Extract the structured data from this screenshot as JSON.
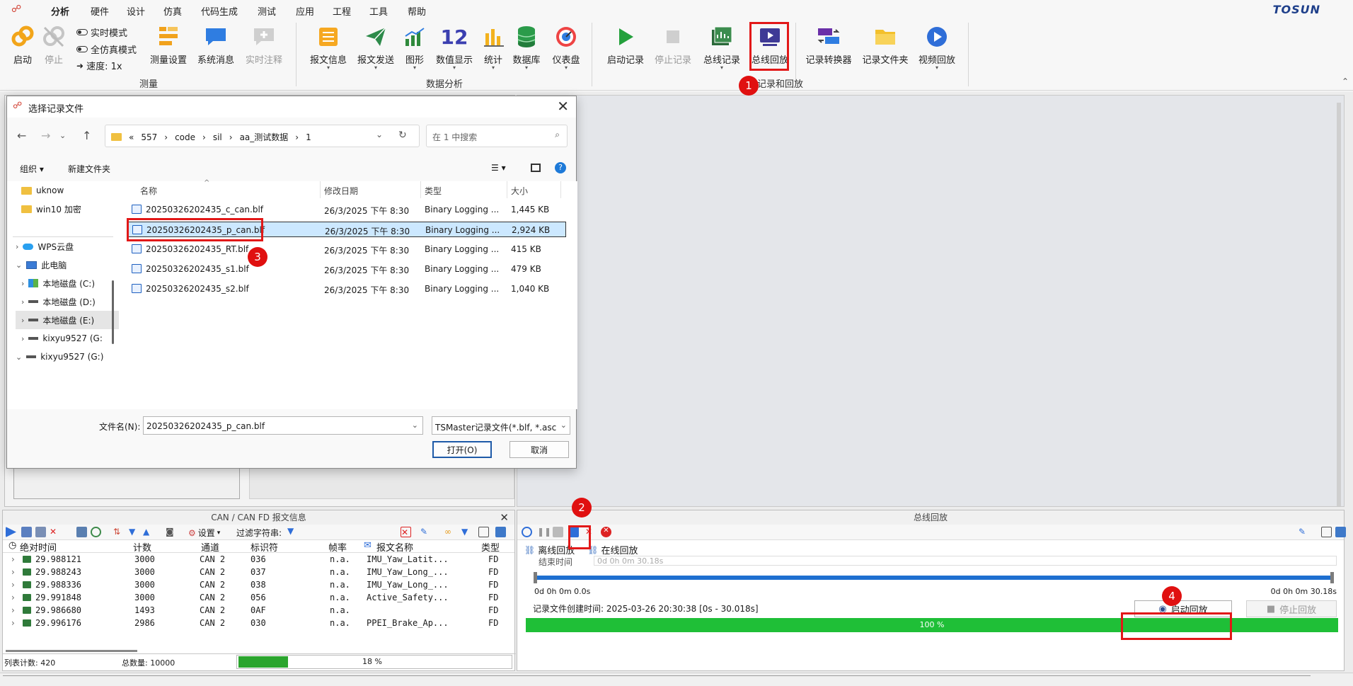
{
  "menubar": {
    "tabs": [
      "分析",
      "硬件",
      "设计",
      "仿真",
      "代码生成",
      "测试",
      "应用",
      "工程",
      "工具",
      "帮助"
    ],
    "active_tab": "分析",
    "brand": "TOSUN"
  },
  "ribbon": {
    "start_label": "启动",
    "stop_label": "停止",
    "realtime_label": "实时模式",
    "fullsim_label": "全仿真模式",
    "speed_label": "速度: 1x",
    "measure_setup_label": "测量设置",
    "sys_msg_label": "系统消息",
    "rt_annot_label": "实时注释",
    "group_measure": "测量",
    "msg_info_label": "报文信息",
    "msg_send_label": "报文发送",
    "graph_label": "图形",
    "num_display_label": "数值显示",
    "num_display_value": "12",
    "stats_label": "统计",
    "db_label": "数据库",
    "dashboard_label": "仪表盘",
    "group_data": "数据分析",
    "start_rec_label": "启动记录",
    "stop_rec_label": "停止记录",
    "bus_rec_label": "总线记录",
    "bus_replay_label": "总线回放",
    "rec_convert_label": "记录转换器",
    "rec_folder_label": "记录文件夹",
    "video_replay_label": "视频回放",
    "group_record": "记录和回放"
  },
  "dialog": {
    "title": "选择记录文件",
    "path": [
      "«",
      "557",
      "code",
      "sil",
      "aa_测试数据",
      "1"
    ],
    "search_placeholder": "在 1 中搜索",
    "organize_label": "组织 ▾",
    "new_folder_label": "新建文件夹",
    "tree": [
      {
        "label": "uknow"
      },
      {
        "label": "win10 加密"
      },
      {
        "label": "WPS云盘"
      },
      {
        "label": "此电脑"
      },
      {
        "label": "本地磁盘 (C:)"
      },
      {
        "label": "本地磁盘 (D:)"
      },
      {
        "label": "本地磁盘 (E:)"
      },
      {
        "label": "kixyu9527 (G:"
      },
      {
        "label": "kixyu9527 (G:)"
      }
    ],
    "columns": {
      "name": "名称",
      "date": "修改日期",
      "type": "类型",
      "size": "大小"
    },
    "files": [
      {
        "name": "20250326202435_c_can.blf",
        "date": "26/3/2025 下午 8:30",
        "type": "Binary Logging ...",
        "size": "1,445 KB"
      },
      {
        "name": "20250326202435_p_can.blf",
        "date": "26/3/2025 下午 8:30",
        "type": "Binary Logging ...",
        "size": "2,924 KB"
      },
      {
        "name": "20250326202435_RT.blf",
        "date": "26/3/2025 下午 8:30",
        "type": "Binary Logging ...",
        "size": "415 KB"
      },
      {
        "name": "20250326202435_s1.blf",
        "date": "26/3/2025 下午 8:30",
        "type": "Binary Logging ...",
        "size": "479 KB"
      },
      {
        "name": "20250326202435_s2.blf",
        "date": "26/3/2025 下午 8:30",
        "type": "Binary Logging ...",
        "size": "1,040 KB"
      }
    ],
    "filename_label": "文件名(N):",
    "filename_value": "20250326202435_p_can.blf",
    "filetype_value": "TSMaster记录文件(*.blf, *.asc",
    "open_label": "打开(O)",
    "cancel_label": "取消"
  },
  "can_panel": {
    "title": "CAN / CAN FD 报文信息",
    "settings_label": "设置",
    "filter_label": "过滤字符串:",
    "columns": [
      "绝对时间",
      "计数",
      "通道",
      "标识符",
      "帧率",
      "报文名称",
      "类型"
    ],
    "rows": [
      {
        "time": "29.988121",
        "count": "3000",
        "chan": "CAN 2",
        "id": "036",
        "rate": "n.a.",
        "name": "IMU_Yaw_Latit...",
        "type": "FD"
      },
      {
        "time": "29.988243",
        "count": "3000",
        "chan": "CAN 2",
        "id": "037",
        "rate": "n.a.",
        "name": "IMU_Yaw_Long_...",
        "type": "FD"
      },
      {
        "time": "29.988336",
        "count": "3000",
        "chan": "CAN 2",
        "id": "038",
        "rate": "n.a.",
        "name": "IMU_Yaw_Long_...",
        "type": "FD"
      },
      {
        "time": "29.991848",
        "count": "3000",
        "chan": "CAN 2",
        "id": "056",
        "rate": "n.a.",
        "name": "Active_Safety...",
        "type": "FD"
      },
      {
        "time": "29.986680",
        "count": "1493",
        "chan": "CAN 2",
        "id": "0AF",
        "rate": "n.a.",
        "name": "",
        "type": "FD"
      },
      {
        "time": "29.996176",
        "count": "2986",
        "chan": "CAN 2",
        "id": "030",
        "rate": "n.a.",
        "name": "PPEI_Brake_Ap...",
        "type": "FD"
      }
    ],
    "list_count": "列表计数: 420",
    "total_count": "总数量: 10000",
    "progress_text": "18 %",
    "progress_fraction": 0.18
  },
  "replay_panel": {
    "title": "总线回放",
    "tab_offline": "离线回放",
    "tab_online": "在线回放",
    "end_time_label": "结束时间",
    "end_time_value": "0d 0h 0m 30.18s",
    "time_start": "0d 0h 0m 0.0s",
    "time_end": "0d 0h 0m 30.18s",
    "created_info": "记录文件创建时间: 2025-03-26 20:30:38 [0s - 30.018s]",
    "start_replay_label": "启动回放",
    "stop_replay_label": "停止回放",
    "progress_text": "100 %",
    "progress_fraction": 1.0
  },
  "annotations": [
    "1",
    "2",
    "3",
    "4"
  ],
  "colors": {
    "highlight": "#e21818",
    "accent": "#1e5aa8",
    "progress": "#1fbf37"
  }
}
